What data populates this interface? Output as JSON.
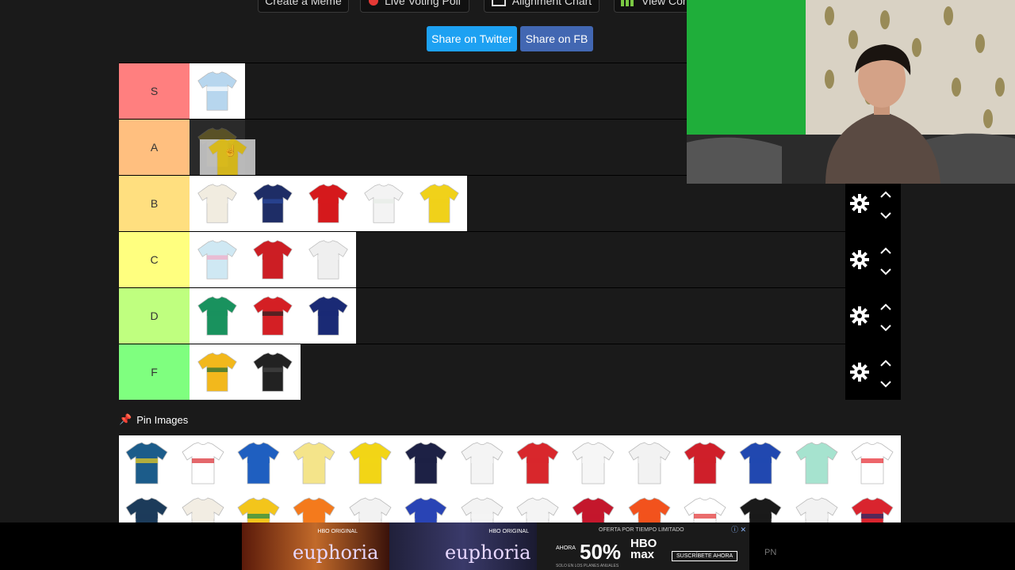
{
  "toolbar": {
    "create_meme": "Create a Meme",
    "live_poll": "Live Voting Poll",
    "alignment_chart": "Alignment Chart",
    "view_community": "View Com"
  },
  "share": {
    "twitter": "Share on Twitter",
    "facebook": "Share on FB"
  },
  "colors": {
    "twitter": "#1da1f2",
    "facebook": "#4267b2",
    "control": "#000000"
  },
  "tiers": [
    {
      "label": "S",
      "color": "#ff7f7f",
      "items": [
        {
          "c1": "#b7d6ee",
          "c2": "#ffffff"
        }
      ]
    },
    {
      "label": "A",
      "color": "#ffbf7f",
      "items": [
        {
          "c1": "#e6c51b",
          "c2": "#e6c51b",
          "drag": true
        }
      ]
    },
    {
      "label": "B",
      "color": "#ffdf7f",
      "items": [
        {
          "c1": "#f1ece0",
          "c2": "#f1ece0"
        },
        {
          "c1": "#1e2d66",
          "c2": "#2b4a9e"
        },
        {
          "c1": "#d5191c",
          "c2": "#d5191c"
        },
        {
          "c1": "#f3f3f3",
          "c2": "#e6ebe5"
        },
        {
          "c1": "#f0d11a",
          "c2": "#f0d11a"
        }
      ]
    },
    {
      "label": "C",
      "color": "#ffff7f",
      "items": [
        {
          "c1": "#cfe8f3",
          "c2": "#f4a9c4"
        },
        {
          "c1": "#cc1e24",
          "c2": "#cc1e24"
        },
        {
          "c1": "#efefef",
          "c2": "#efefef"
        }
      ]
    },
    {
      "label": "D",
      "color": "#bfff7f",
      "items": [
        {
          "c1": "#19925e",
          "c2": "#19925e"
        },
        {
          "c1": "#d41f24",
          "c2": "#222"
        },
        {
          "c1": "#1a2a75",
          "c2": "#1a2a75"
        }
      ]
    },
    {
      "label": "F",
      "color": "#7fff7f",
      "items": [
        {
          "c1": "#f2b81c",
          "c2": "#1b6b34"
        },
        {
          "c1": "#222",
          "c2": "#444"
        }
      ]
    }
  ],
  "pin_images": "Pin Images",
  "pool": [
    [
      {
        "c1": "#1c5c8a",
        "c2": "#f4d21c"
      },
      {
        "c1": "#ffffff",
        "c2": "#d9262c"
      },
      {
        "c1": "#1f5fc0",
        "c2": "#1f5fc0"
      },
      {
        "c1": "#f4e48a",
        "c2": "#f4e48a"
      },
      {
        "c1": "#f2d516",
        "c2": "#f2d516"
      },
      {
        "c1": "#1d2145",
        "c2": "#1d2145"
      },
      {
        "c1": "#f4f4f4",
        "c2": "#f4f4f4"
      },
      {
        "c1": "#d8272c",
        "c2": "#d8272c"
      },
      {
        "c1": "#f6f6f6",
        "c2": "#f6f6f6"
      },
      {
        "c1": "#f2f2f2",
        "c2": "#f2f2f2"
      },
      {
        "c1": "#cf1f2a",
        "c2": "#cf1f2a"
      },
      {
        "c1": "#2148b0",
        "c2": "#2148b0"
      },
      {
        "c1": "#a6e3cf",
        "c2": "#a6e3cf"
      },
      {
        "c1": "#ffffff",
        "c2": "#e5242b"
      }
    ],
    [
      {
        "c1": "#1c3b5a",
        "c2": "#1c3b5a"
      },
      {
        "c1": "#f2ede3",
        "c2": "#f2ede3"
      },
      {
        "c1": "#f3c51b",
        "c2": "#19894a"
      },
      {
        "c1": "#f47a1c",
        "c2": "#f47a1c"
      },
      {
        "c1": "#f2f2f2",
        "c2": "#f2f2f2"
      },
      {
        "c1": "#2944b5",
        "c2": "#2944b5"
      },
      {
        "c1": "#f3f3f3",
        "c2": "#f3f3f3"
      },
      {
        "c1": "#f4f4f4",
        "c2": "#f4f4f4"
      },
      {
        "c1": "#c4172c",
        "c2": "#c4172c"
      },
      {
        "c1": "#f2521d",
        "c2": "#f2521d"
      },
      {
        "c1": "#ffffff",
        "c2": "#e12d2d"
      },
      {
        "c1": "#1a1a1a",
        "c2": "#1a1a1a"
      },
      {
        "c1": "#f2f2f2",
        "c2": "#f2f2f2"
      },
      {
        "c1": "#d9242e",
        "c2": "#1c2c6b"
      }
    ]
  ],
  "ads": {
    "brand1": "euphoria",
    "brand2": "euphoria",
    "network": "HBO ORIGINAL",
    "offer_tag": "OFERTA POR TIEMPO LIMITADO",
    "ahora": "AHORA",
    "discount": "50%",
    "hbo_max": "HBO max",
    "subscribe": "SUSCRÍBETE AHORA",
    "fine_print": "SOLO EN LOS PLANES ANUALES",
    "pn": "PN"
  }
}
